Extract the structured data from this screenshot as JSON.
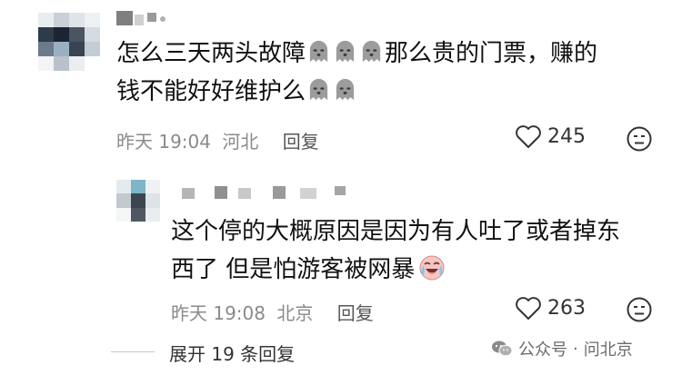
{
  "comment1": {
    "username": "▇ ▘。",
    "text_line1_a": "怎么三天两头故障",
    "text_line1_b": "那么贵的门票，赚的",
    "text_line2": "钱不能好好维护么",
    "ghost_emoji_count_line1": 3,
    "ghost_emoji_count_line2": 2,
    "time": "昨天 19:04",
    "location": "河北",
    "reply_label": "回复",
    "likes": "245"
  },
  "reply1": {
    "username": "▝ ▘ ▖ ▗ ▖",
    "text_line1": "这个停的大概原因是因为有人吐了或者掉东",
    "text_line2": "西了 但是怕游客被网暴",
    "time": "昨天 19:08",
    "location": "北京",
    "reply_label": "回复",
    "likes": "263"
  },
  "expand_label": "展开 19 条回复",
  "watermark": {
    "prefix": "公众号",
    "separator": "·",
    "name": "问北京"
  },
  "icons": {
    "like": "heart-outline-icon",
    "dislike": "meh-face-icon",
    "watermark": "wechat-icon",
    "emoji1": "ghost-sigh-emoji",
    "emoji2": "crying-laughing-emoji"
  }
}
